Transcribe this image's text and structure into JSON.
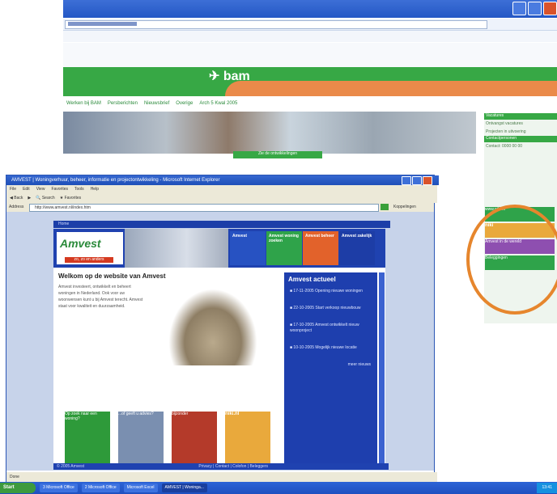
{
  "background_window": {
    "nav_items": [
      "Werken bij BAM",
      "Persberichten",
      "Nieuwsbrief",
      "Overige",
      "Arch 5 Kwal 2005"
    ],
    "logo_text": "bam",
    "banner_label": "Zie de ontwikkelingen",
    "sidebar_heads": [
      "Vacatures",
      "Contactpersonen"
    ],
    "sidebar_texts": [
      "Ontvangst vacatures",
      "Projecten in uitvoering",
      "Contact: 0000 00 00"
    ],
    "promo_items": [
      "www.niki.nl",
      "niki",
      "Amvest in de wereld",
      "Beleggingen"
    ]
  },
  "foreground_window": {
    "title": "AMVEST | Woningverhuur, beheer, informatie en projectontwikkeling - Microsoft Internet Explorer",
    "menu": [
      "File",
      "Edit",
      "View",
      "Favorites",
      "Tools",
      "Help"
    ],
    "toolbar": [
      "Back",
      "Search",
      "Favorites"
    ],
    "address_label": "Address",
    "address_value": "http://www.amvest.nl/index.htm",
    "links_label": "Koppelingen",
    "breadcrumb": "Home",
    "logo": "Amvest",
    "logo_sub": "zo, zo en anders",
    "tiles": [
      "Amvest",
      "Amvest woning zoeken",
      "Amvest beheer",
      "Amvest zakelijk"
    ],
    "tile_colors": [
      "#2752c2",
      "#2fa34a",
      "#e2622b",
      "#1d3da6"
    ],
    "welcome": "Welkom op de website van Amvest",
    "intro_text": "Amvest investeert, ontwikkelt en beheert woningen in Nederland. Ook voor uw woonwensen kunt u bij Amvest terecht. Amvest staat voor kwaliteit en duurzaamheid.",
    "news_title": "Amvest actueel",
    "news_items": [
      "17-11-2005 Opening nieuwe woningen",
      "22-10-2005 Start verkoop nieuwbouw",
      "17-10-2005 Amvest ontwikkelt nieuw woonproject",
      "10-10-2005 Mogelijk nieuwe locatie"
    ],
    "news_more": "meer nieuws",
    "cards": [
      "Op zoek naar een woning?",
      "...of geeft u advies?",
      "bijzonder",
      "niki.nl"
    ],
    "footer": "© 2005 Amvest",
    "footer_links": "Privacy | Contact | Colofon | Beleggers",
    "status": "Done"
  },
  "taskbar": {
    "start": "Start",
    "items": [
      "3 Microsoft Office",
      "2 Microsoft Office",
      "Microsoft Excel",
      "AMVEST | Woninga..."
    ],
    "clock": "13:41"
  }
}
